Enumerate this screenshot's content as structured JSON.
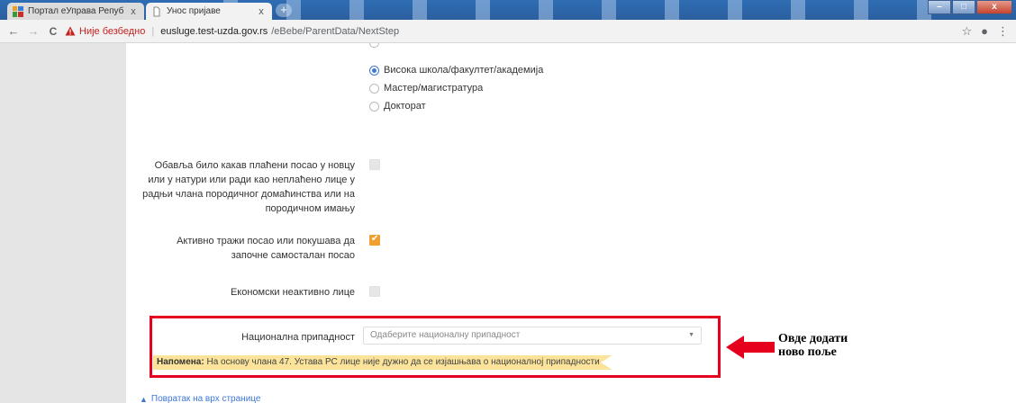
{
  "browser": {
    "tabs": [
      {
        "title": "Портал еУправа Републике Срб",
        "active": false
      },
      {
        "title": "Унос пријаве",
        "active": true
      }
    ],
    "new_tab_symbol": "+",
    "window_buttons": {
      "minimize": "–",
      "maximize": "□",
      "close": "x"
    },
    "nav": {
      "back": "←",
      "forward": "→",
      "reload": "C"
    },
    "address": {
      "security_warning": "Није безбедно",
      "separator": "|",
      "host": "eusluge.test-uzda.gov.rs",
      "path": "/eBebe/ParentData/NextStep"
    },
    "toolbar_icons": {
      "bookmark": "☆",
      "account": "●",
      "menu": "⋮"
    }
  },
  "form": {
    "education_options": [
      {
        "label": "Висока школа/факултет/академија",
        "checked": true
      },
      {
        "label": "Мастер/магистратура",
        "checked": false
      },
      {
        "label": "Докторат",
        "checked": false
      }
    ],
    "fields": [
      {
        "label": "Обавља било какав плаћени посао у новцу или у натури или ради као неплаћено лице у радњи члана породичног домаћинства или на породичном имању",
        "checked": false
      },
      {
        "label": "Активно тражи посао или покушава да започне самосталан посао",
        "checked": true
      },
      {
        "label": "Економски неактивно лице",
        "checked": false
      }
    ],
    "nationality": {
      "label": "Национална припадност",
      "placeholder": "Одаберите националну припадност",
      "arrow": "▼"
    },
    "note": {
      "prefix": "Напомена:",
      "text": " На основу члана 47. Устава РС лице није дужно да се изјашњава о националној припадности"
    },
    "back_to_top": "Повратак на врх странице",
    "back_to_top_icon": "▲"
  },
  "annotation": {
    "line1": "Овде додати",
    "line2": "ново поље",
    "color": "#e5001e"
  }
}
